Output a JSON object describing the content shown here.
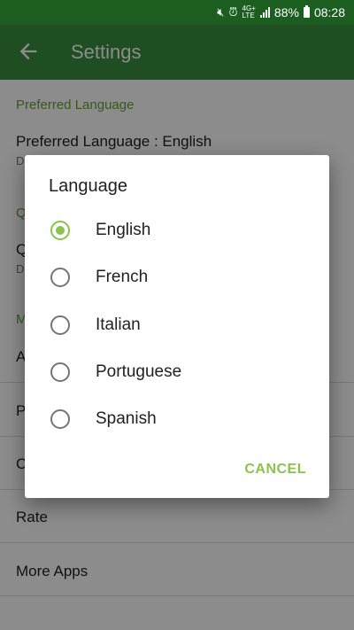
{
  "status_bar": {
    "network": "4G+",
    "network_sub": "LTE",
    "battery": "88%",
    "time": "08:28",
    "icons": [
      "mute-icon",
      "alarm-icon",
      "signal-icon",
      "battery-icon"
    ]
  },
  "toolbar": {
    "title": "Settings",
    "back_icon": "arrow-left-icon"
  },
  "settings": {
    "section1_header": "Preferred Language",
    "pref_language_title": "Preferred Language : English",
    "pref_language_summary_visible": "D",
    "section2_header_visible": "Q",
    "row2_title_visible": "Q",
    "row2_summary_visible": "D",
    "section3_header_visible": "M",
    "row_a_visible": "A",
    "row_p_visible": "P",
    "row_c_visible": "C",
    "rate": "Rate",
    "more_apps": "More Apps"
  },
  "dialog": {
    "title": "Language",
    "options": [
      {
        "label": "English",
        "selected": true
      },
      {
        "label": "French",
        "selected": false
      },
      {
        "label": "Italian",
        "selected": false
      },
      {
        "label": "Portuguese",
        "selected": false
      },
      {
        "label": "Spanish",
        "selected": false
      }
    ],
    "cancel": "CANCEL"
  },
  "colors": {
    "status_bar": "#1b5e20",
    "toolbar": "#388e3c",
    "accent": "#8bc34a",
    "section_header": "#689f38"
  }
}
